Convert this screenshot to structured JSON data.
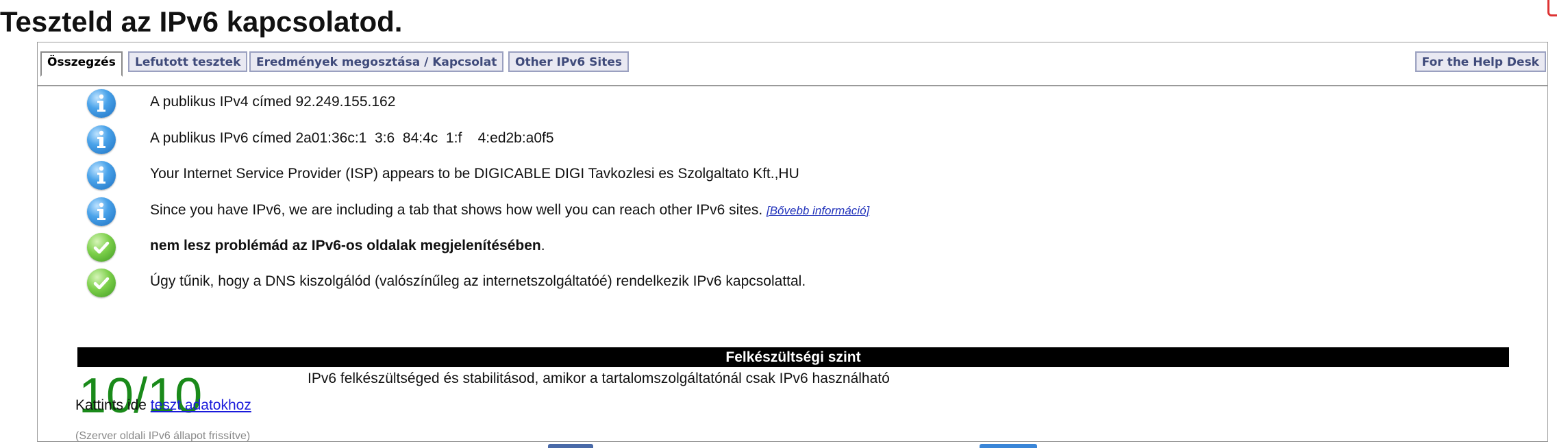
{
  "page": {
    "title": "Teszteld az IPv6 kapcsolatod."
  },
  "tabs": [
    {
      "label": "Összegzés",
      "active": true
    },
    {
      "label": "Lefutott tesztek",
      "active": false
    },
    {
      "label": "Eredmények megosztása / Kapcsolat",
      "active": false
    },
    {
      "label": "Other IPv6 Sites",
      "active": false
    },
    {
      "label": "For the Help Desk",
      "active": false
    }
  ],
  "summary": {
    "items": [
      {
        "icon": "info-icon",
        "text": "A publikus IPv4 címed 92.249.155.162"
      },
      {
        "icon": "info-icon",
        "text": "A publikus IPv6 címed 2a01:36c:1  3:6  84:4c  1:f    4:ed2b:a0f5"
      },
      {
        "icon": "info-icon",
        "text": "Your Internet Service Provider (ISP) appears to be DIGICABLE DIGI Tavkozlesi es Szolgaltato Kft.,HU"
      },
      {
        "icon": "info-icon",
        "text": "Since you have IPv6, we are including a tab that shows how well you can reach other IPv6 sites. ",
        "link": "[Bővebb információ]"
      },
      {
        "icon": "check-icon",
        "bold": "nem lesz problémád az IPv6-os oldalak megjelenítésében",
        "suffix": "."
      },
      {
        "icon": "check-icon",
        "text": "Úgy tűnik, hogy a DNS kiszolgálód (valószínűleg az internetszolgáltatóé) rendelkezik IPv6 kapcsolattal."
      }
    ]
  },
  "readiness": {
    "header": "Felkészültségi szint",
    "score": "10/10",
    "description": "IPv6 felkészültséged és stabilitásod, amikor a tartalomszolgáltatónál csak IPv6 használható"
  },
  "details": {
    "prefix": "Kattints ide ",
    "link": "teszt adatokhoz"
  },
  "server_note": "(Szerver oldali IPv6 állapot frissítve)",
  "colors": {
    "tab_text": "#3f4a7a",
    "tab_bg": "#e9e9f2",
    "score_green": "#1a8a1a",
    "link_blue": "#1a1adb",
    "info_blue": "#1c6fc0",
    "ok_green": "#3f9a22",
    "bar_bg": "#000000"
  }
}
